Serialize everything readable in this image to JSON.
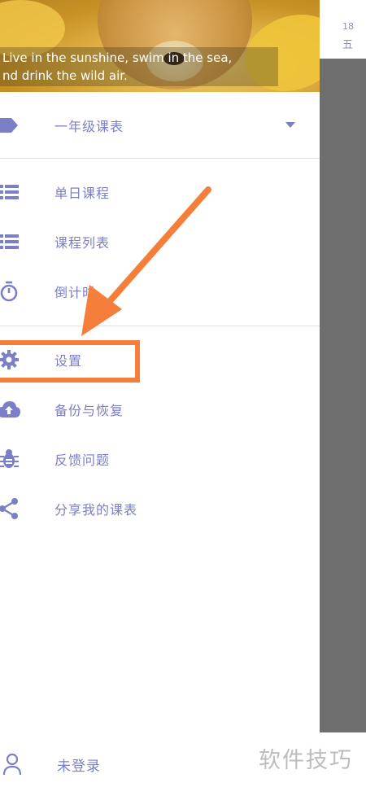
{
  "header": {
    "quote_line1": "Live in the sunshine, swim in the sea,",
    "quote_line2": "nd drink the wild air."
  },
  "schedule_selector": {
    "label": "一年级课表"
  },
  "menu": {
    "items": [
      {
        "label": "单日课程",
        "icon": "list-icon"
      },
      {
        "label": "课程列表",
        "icon": "list-icon"
      },
      {
        "label": "倒计时",
        "icon": "timer-icon"
      },
      {
        "label": "设置",
        "icon": "gear-icon"
      },
      {
        "label": "备份与恢复",
        "icon": "cloud-upload-icon"
      },
      {
        "label": "反馈问题",
        "icon": "bug-icon"
      },
      {
        "label": "分享我的课表",
        "icon": "share-icon"
      }
    ]
  },
  "account": {
    "label": "未登录",
    "icon": "user-icon"
  },
  "background": {
    "date_number": "18",
    "weekday": "五"
  },
  "watermark": "软件技巧",
  "colors": {
    "accent": "#7b7fc6",
    "annotation": "#f57e3a",
    "scrim": "#6e6e6e"
  }
}
